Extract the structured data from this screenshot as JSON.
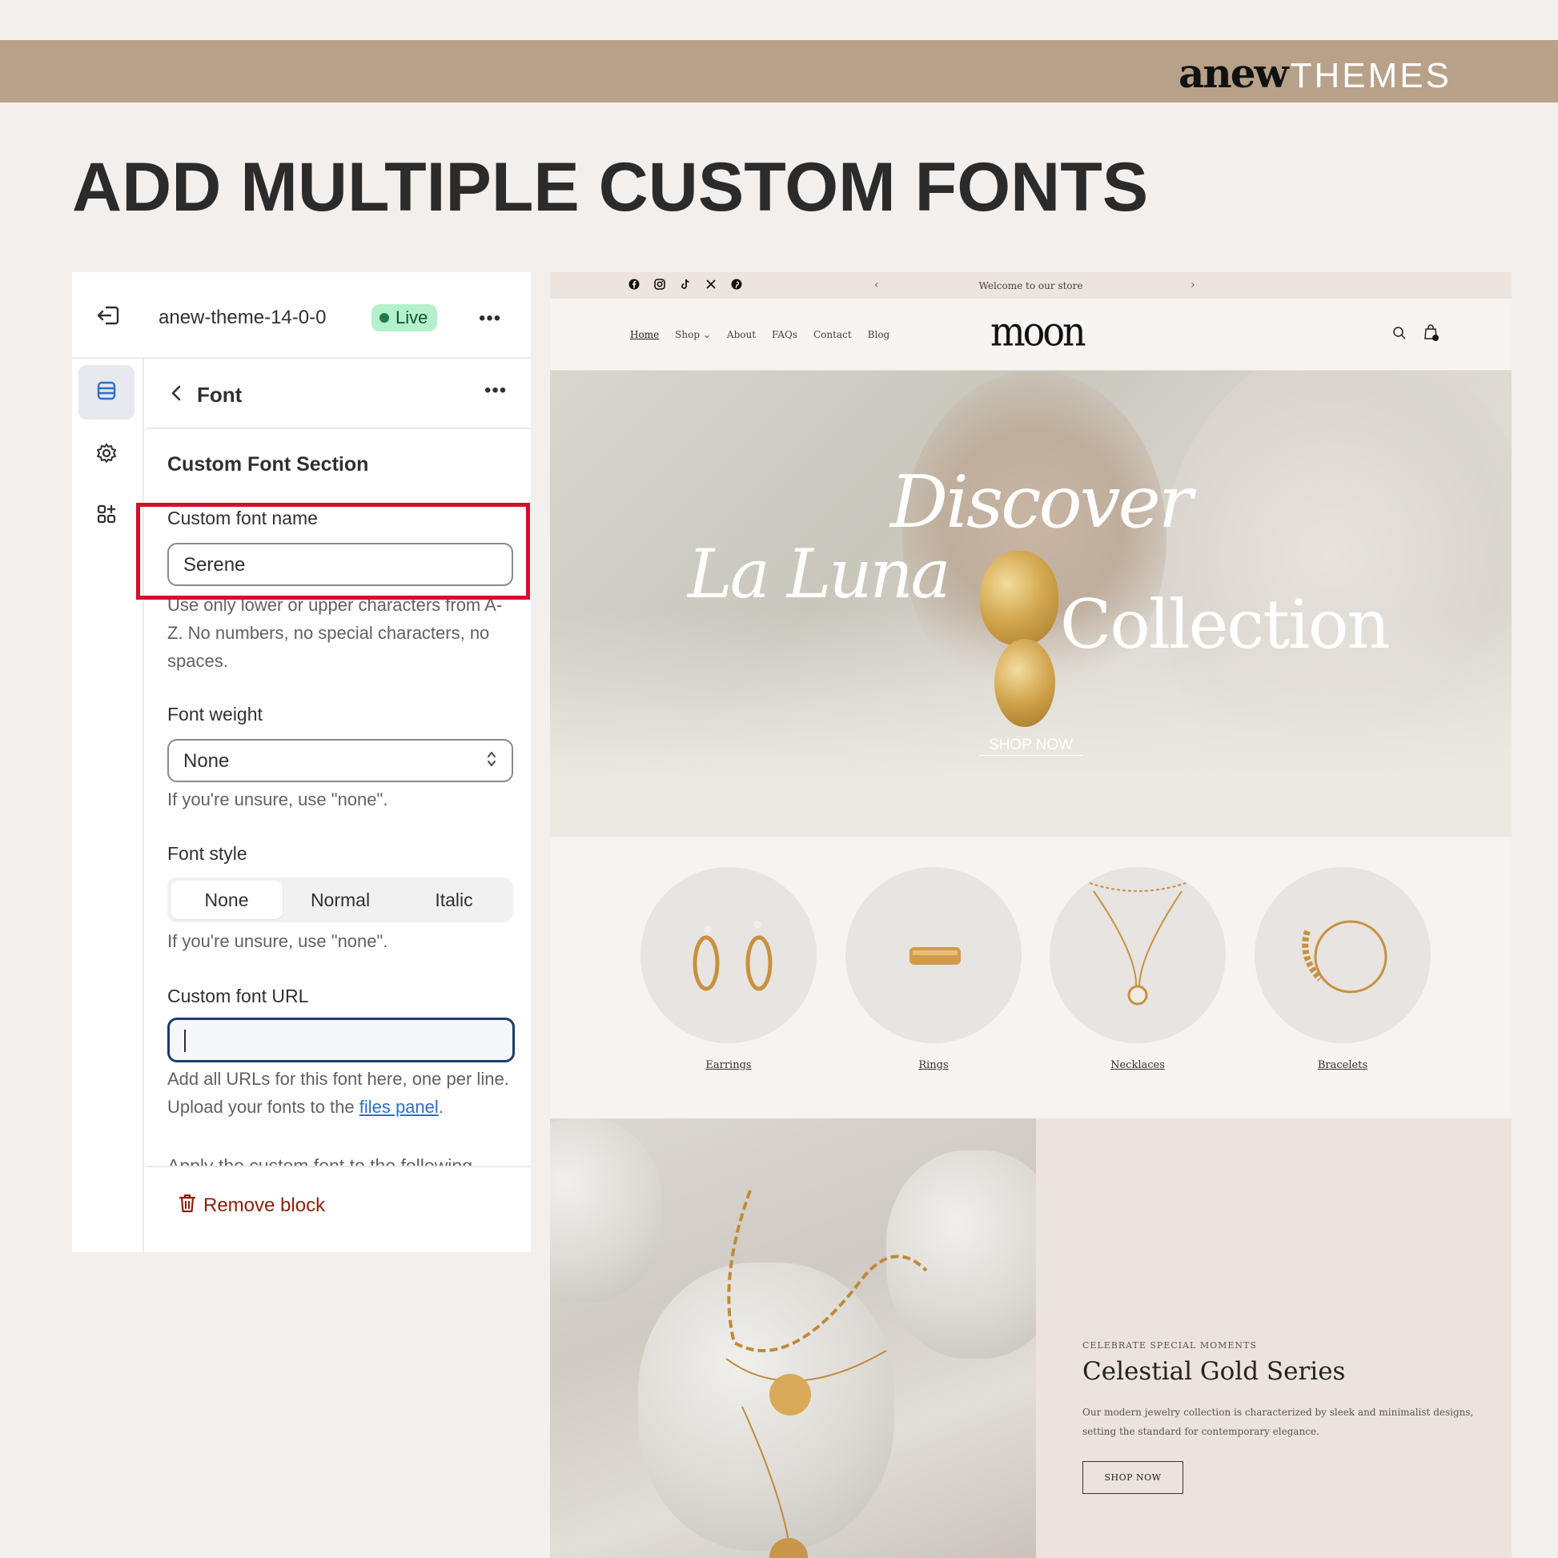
{
  "banner": {
    "brand_bold": "anew",
    "brand_light": "THEMES"
  },
  "headline": "ADD MULTIPLE CUSTOM FONTS",
  "editor": {
    "theme_name": "anew-theme-14-0-0",
    "live_badge": "Live",
    "more": "•••",
    "pane_title": "Font",
    "section_title": "Custom Font Section",
    "font_name": {
      "label": "Custom font name",
      "value": "Serene",
      "help": "Use only lower or upper characters from A-Z. No numbers, no special characters, no spaces."
    },
    "font_weight": {
      "label": "Font weight",
      "value": "None",
      "help": "If you're unsure, use \"none\"."
    },
    "font_style": {
      "label": "Font style",
      "options": [
        "None",
        "Normal",
        "Italic"
      ],
      "selected": "None",
      "help": "If you're unsure, use \"none\"."
    },
    "font_url": {
      "label": "Custom font URL",
      "value": "",
      "help_prefix": "Add all URLs for this font here, one per line. Upload your fonts to the ",
      "help_link": "files panel",
      "help_suffix": "."
    },
    "cut_text": "Apply the custom font to the following",
    "remove_label": "Remove block"
  },
  "store": {
    "announcement": "Welcome to our store",
    "nav": [
      "Home",
      "Shop",
      "About",
      "FAQs",
      "Contact",
      "Blog"
    ],
    "logo": "moon",
    "hero": {
      "line1": "Discover",
      "line2": "La Luna",
      "line3": "Collection",
      "cta": "SHOP NOW"
    },
    "categories": [
      "Earrings",
      "Rings",
      "Necklaces",
      "Bracelets"
    ],
    "feature": {
      "eyebrow": "CELEBRATE SPECIAL MOMENTS",
      "title": "Celestial Gold Series",
      "body": "Our modern jewelry collection is characterized by sleek and minimalist designs, setting the standard for contemporary elegance.",
      "cta": "SHOP NOW"
    }
  },
  "colors": {
    "banner": "#b8a189",
    "highlight_box": "#d40f2a",
    "live_badge": "#b4f0cb",
    "focused_input": "#1d3a70",
    "remove": "#8e1f0b"
  },
  "icons": [
    "exit-icon",
    "sections-icon",
    "gear-icon",
    "apps-icon",
    "chevron-left-icon",
    "chevron-updown-icon",
    "trash-icon",
    "facebook-icon",
    "instagram-icon",
    "tiktok-icon",
    "x-icon",
    "pinterest-icon",
    "search-icon",
    "cart-icon"
  ]
}
